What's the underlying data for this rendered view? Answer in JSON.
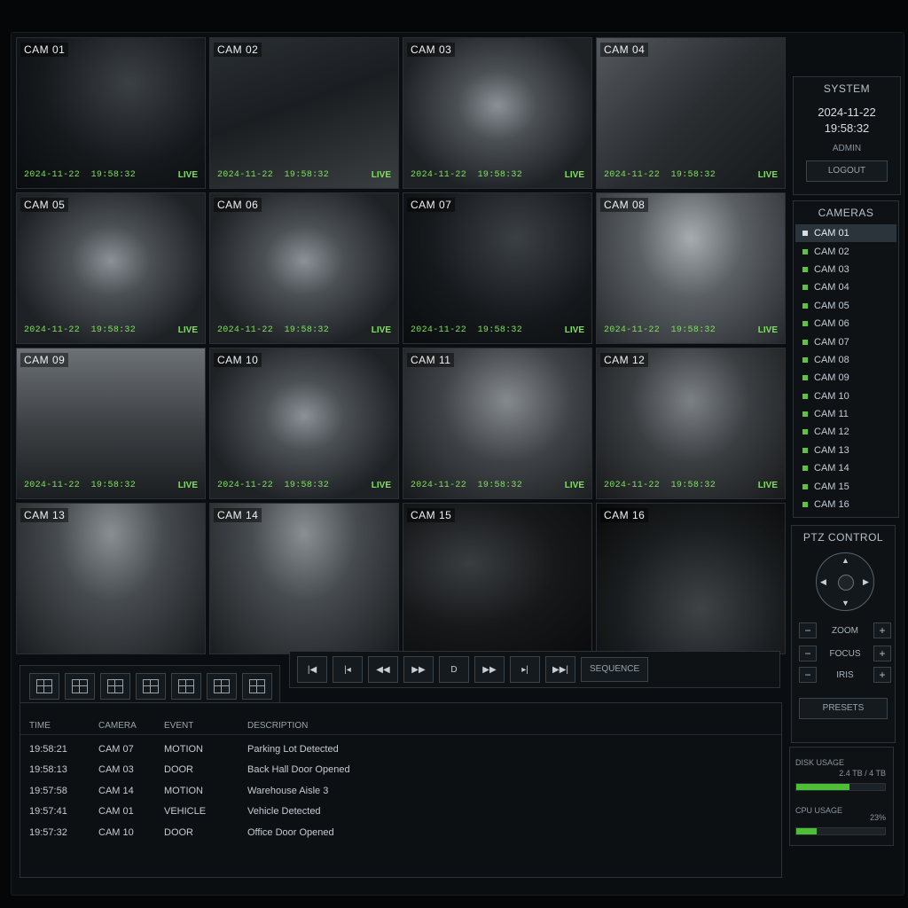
{
  "cameras": [
    {
      "label": "CAM 01",
      "date": "2024-11-22",
      "time": "19:58:32",
      "status": "LIVE",
      "scene": "parking"
    },
    {
      "label": "CAM 02",
      "date": "2024-11-22",
      "time": "19:58:32",
      "status": "LIVE",
      "scene": "walkway"
    },
    {
      "label": "CAM 03",
      "date": "2024-11-22",
      "time": "19:58:32",
      "status": "LIVE",
      "scene": "hall"
    },
    {
      "label": "CAM 04",
      "date": "2024-11-22",
      "time": "19:58:32",
      "status": "LIVE",
      "scene": "stairs"
    },
    {
      "label": "CAM 05",
      "date": "2024-11-22",
      "time": "19:58:32",
      "status": "LIVE",
      "scene": "hall"
    },
    {
      "label": "CAM 06",
      "date": "2024-11-22",
      "time": "19:58:32",
      "status": "LIVE",
      "scene": "hall"
    },
    {
      "label": "CAM 07",
      "date": "2024-11-22",
      "time": "19:58:32",
      "status": "LIVE",
      "scene": "parking"
    },
    {
      "label": "CAM 08",
      "date": "2024-11-22",
      "time": "19:58:32",
      "status": "LIVE",
      "scene": "storage"
    },
    {
      "label": "CAM 09",
      "date": "2024-11-22",
      "time": "19:58:32",
      "status": "LIVE",
      "scene": "lobby"
    },
    {
      "label": "CAM 10",
      "date": "2024-11-22",
      "time": "19:58:32",
      "status": "LIVE",
      "scene": "hall"
    },
    {
      "label": "CAM 11",
      "date": "2024-11-22",
      "time": "19:58:32",
      "status": "LIVE",
      "scene": "aisle"
    },
    {
      "label": "CAM 12",
      "date": "2024-11-22",
      "time": "19:58:32",
      "status": "LIVE",
      "scene": "dock"
    },
    {
      "label": "CAM 13",
      "date": "",
      "time": "",
      "status": "",
      "scene": "warehouse"
    },
    {
      "label": "CAM 14",
      "date": "",
      "time": "",
      "status": "",
      "scene": "warehouse"
    },
    {
      "label": "CAM 15",
      "date": "",
      "time": "",
      "status": "",
      "scene": "dark"
    },
    {
      "label": "CAM 16",
      "date": "",
      "time": "",
      "status": "",
      "scene": "yard"
    }
  ],
  "system": {
    "title": "SYSTEM",
    "date": "2024-11-22",
    "time": "19:58:32",
    "user": "ADMIN",
    "logout": "LOGOUT"
  },
  "camera_list": {
    "title": "CAMERAS",
    "items": [
      "CAM 01",
      "CAM 02",
      "CAM 03",
      "CAM 04",
      "CAM 05",
      "CAM 06",
      "CAM 07",
      "CAM 08",
      "CAM 09",
      "CAM 10",
      "CAM 11",
      "CAM 12",
      "CAM 13",
      "CAM 14",
      "CAM 15",
      "CAM 16"
    ],
    "selected_index": 0
  },
  "ptz": {
    "title": "PTZ CONTROL",
    "zoom": "ZOOM",
    "focus": "FOCUS",
    "iris": "IRIS",
    "minus": "−",
    "plus": "+",
    "presets": "PRESETS"
  },
  "usage": {
    "disk_label": "DISK USAGE",
    "disk_value": "2.4 TB / 4 TB",
    "disk_fraction": 0.6,
    "cpu_label": "CPU USAGE",
    "cpu_value": "23%",
    "cpu_fraction": 0.23
  },
  "toolbar": {
    "sequence": "SEQUENCE"
  },
  "events": {
    "headers": {
      "time": "TIME",
      "camera": "CAMERA",
      "event": "EVENT",
      "description": "DESCRIPTION"
    },
    "rows": [
      {
        "time": "19:58:21",
        "camera": "CAM 07",
        "event": "MOTION",
        "description": "Parking Lot Detected"
      },
      {
        "time": "19:58:13",
        "camera": "CAM 03",
        "event": "DOOR",
        "description": "Back Hall Door Opened"
      },
      {
        "time": "19:57:58",
        "camera": "CAM 14",
        "event": "MOTION",
        "description": "Warehouse Aisle 3"
      },
      {
        "time": "19:57:41",
        "camera": "CAM 01",
        "event": "VEHICLE",
        "description": "Vehicle Detected"
      },
      {
        "time": "19:57:32",
        "camera": "CAM 10",
        "event": "DOOR",
        "description": "Office Door Opened"
      }
    ]
  },
  "colors": {
    "accent": "#5ec43e",
    "overlay_text": "#7ee05c",
    "panel_border": "#2b3238"
  }
}
